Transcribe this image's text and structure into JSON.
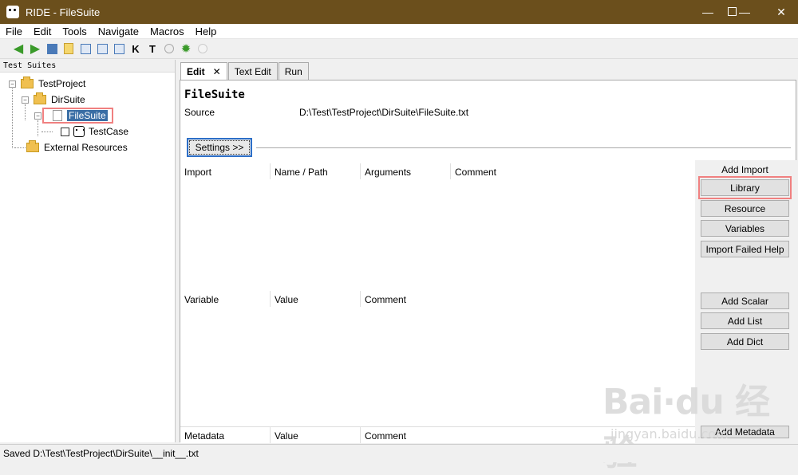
{
  "window": {
    "title": "RIDE - FileSuite"
  },
  "menu": [
    "File",
    "Edit",
    "Tools",
    "Navigate",
    "Macros",
    "Help"
  ],
  "toolbar": {
    "icons": [
      "back-icon",
      "forward-icon",
      "save-icon",
      "open-folder-icon",
      "open-file-icon",
      "save-all-icon",
      "import-icon",
      "k-icon",
      "t-icon",
      "run-icon",
      "debug-icon",
      "stop-icon"
    ]
  },
  "tree": {
    "header": "Test Suites",
    "nodes": [
      {
        "label": "TestProject"
      },
      {
        "label": "DirSuite"
      },
      {
        "label": "FileSuite"
      },
      {
        "label": "TestCase"
      },
      {
        "label": "External Resources"
      }
    ]
  },
  "tabs": [
    "Edit",
    "Text Edit",
    "Run"
  ],
  "editor": {
    "suite_name": "FileSuite",
    "source_label": "Source",
    "source_value": "D:\\Test\\TestProject\\DirSuite\\FileSuite.txt",
    "settings_button": "Settings >>"
  },
  "import_table": {
    "headers": [
      "Import",
      "Name / Path",
      "Arguments",
      "Comment"
    ]
  },
  "variable_table": {
    "headers": [
      "Variable",
      "Value",
      "Comment"
    ]
  },
  "metadata_table": {
    "headers": [
      "Metadata",
      "Value",
      "Comment"
    ]
  },
  "side_panel": {
    "add_import_label": "Add Import",
    "library": "Library",
    "resource": "Resource",
    "variables": "Variables",
    "import_failed_help": "Import Failed Help",
    "add_scalar": "Add Scalar",
    "add_list": "Add List",
    "add_dict": "Add Dict",
    "add_metadata": "Add Metadata"
  },
  "status": "Saved D:\\Test\\TestProject\\DirSuite\\__init__.txt",
  "watermark": {
    "brand": "Bai·du 经验",
    "url": "jingyan.baidu.com"
  },
  "colors": {
    "titlebar": "#6b4f1c",
    "selection": "#3a6ea5",
    "highlight": "#f08080",
    "focus": "#2d6fc8"
  }
}
